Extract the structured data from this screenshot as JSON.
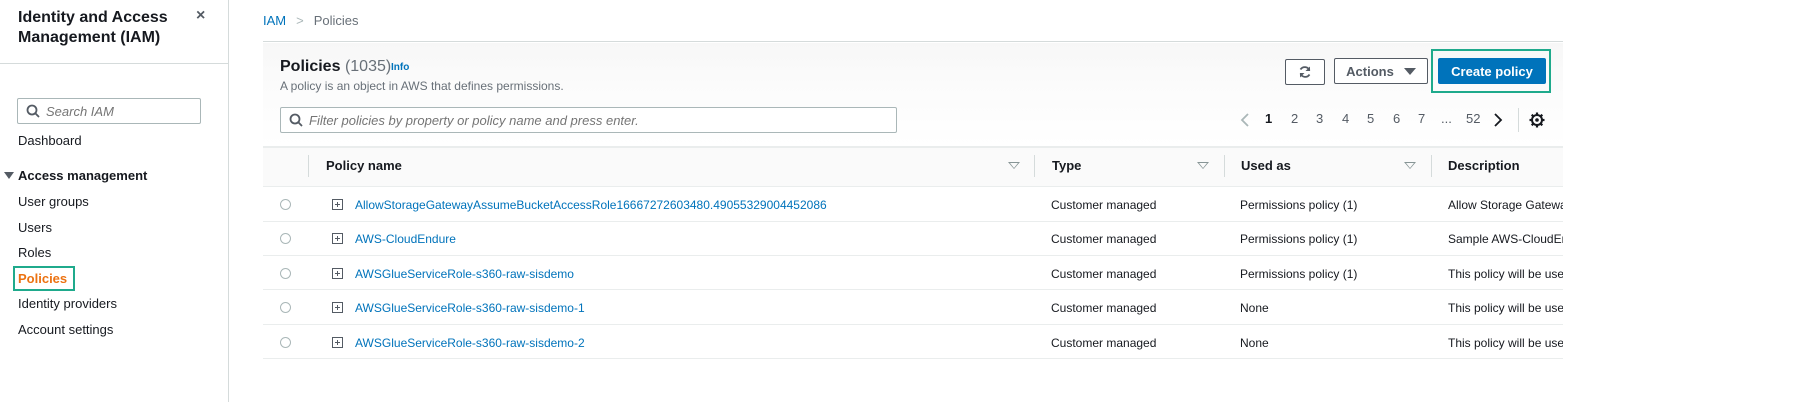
{
  "sidebar": {
    "title": "Identity and Access Management (IAM)",
    "close_icon": "×",
    "search_placeholder": "Search IAM",
    "dashboard": "Dashboard",
    "section": "Access management",
    "items": [
      {
        "label": "User groups"
      },
      {
        "label": "Users"
      },
      {
        "label": "Roles"
      },
      {
        "label": "Policies"
      },
      {
        "label": "Identity providers"
      },
      {
        "label": "Account settings"
      }
    ]
  },
  "breadcrumb": {
    "root": "IAM",
    "current": "Policies"
  },
  "header": {
    "title": "Policies",
    "count": "(1035)",
    "info": "Info",
    "description": "A policy is an object in AWS that defines permissions.",
    "actions_label": "Actions",
    "create_label": "Create policy"
  },
  "filter": {
    "placeholder": "Filter policies by property or policy name and press enter."
  },
  "pagination": {
    "pages": [
      "1",
      "2",
      "3",
      "4",
      "5",
      "6",
      "7",
      "...",
      "52"
    ],
    "current": "1"
  },
  "table": {
    "columns": [
      "Policy name",
      "Type",
      "Used as",
      "Description"
    ],
    "rows": [
      {
        "name": "AllowStorageGatewayAssumeBucketAccessRole16667272603480.49055329004452086",
        "type": "Customer managed",
        "used_as": "Permissions policy (1)",
        "description": "Allow Storage Gatewa"
      },
      {
        "name": "AWS-CloudEndure",
        "type": "Customer managed",
        "used_as": "Permissions policy (1)",
        "description": "Sample AWS-CloudEn"
      },
      {
        "name": "AWSGlueServiceRole-s360-raw-sisdemo",
        "type": "Customer managed",
        "used_as": "Permissions policy (1)",
        "description": "This policy will be use"
      },
      {
        "name": "AWSGlueServiceRole-s360-raw-sisdemo-1",
        "type": "Customer managed",
        "used_as": "None",
        "description": "This policy will be use"
      },
      {
        "name": "AWSGlueServiceRole-s360-raw-sisdemo-2",
        "type": "Customer managed",
        "used_as": "None",
        "description": "This policy will be use"
      }
    ]
  },
  "colors": {
    "accent": "#0073bb",
    "active_nav": "#ec7211",
    "highlight_outline": "#1faa8c"
  },
  "icons": [
    "close-icon",
    "search-icon",
    "refresh-icon",
    "caret-down-icon",
    "chevron-left-icon",
    "chevron-right-icon",
    "gear-icon",
    "sort-icon",
    "expand-icon"
  ]
}
